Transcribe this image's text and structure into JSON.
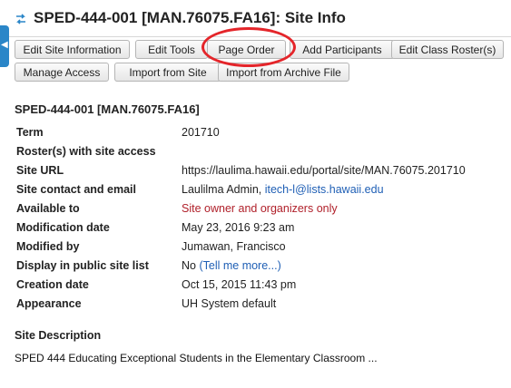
{
  "header": {
    "title": "SPED-444-001 [MAN.76075.FA16]: Site Info",
    "side_tab_icon": "chevron-left-icon",
    "title_icon": "swap-arrows-icon"
  },
  "toolbar": {
    "buttons": [
      {
        "label": "Edit Site Information"
      },
      {
        "label": "Edit Tools"
      },
      {
        "label": "Page Order"
      },
      {
        "label": "Add Participants"
      },
      {
        "label": "Edit Class Roster(s)"
      },
      {
        "label": "Manage Access"
      },
      {
        "label": "Import from Site"
      },
      {
        "label": "Import from Archive File"
      }
    ],
    "highlight_color": "#e4252a"
  },
  "site": {
    "section_title": "SPED-444-001 [MAN.76075.FA16]",
    "rows": [
      {
        "label": "Term",
        "value": "201710"
      },
      {
        "label": "Roster(s) with site access",
        "value": ""
      },
      {
        "label": "Site URL",
        "value": "https://laulima.hawaii.edu/portal/site/MAN.76075.201710"
      },
      {
        "label": "Site contact and email",
        "value": "Laulilma Admin,",
        "link": "itech-l@lists.hawaii.edu"
      },
      {
        "label": "Available to",
        "value": "Site owner and organizers only"
      },
      {
        "label": "Modification date",
        "value": "May 23, 2016 9:23 am"
      },
      {
        "label": "Modified by",
        "value": "Jumawan, Francisco"
      },
      {
        "label": "Display in public site list",
        "value": "No",
        "link": "(Tell me more...)"
      },
      {
        "label": "Creation date",
        "value": "Oct 15, 2015 11:43 pm"
      },
      {
        "label": "Appearance",
        "value": "UH System default"
      }
    ]
  },
  "description": {
    "title": "Site Description",
    "text": "SPED 444 Educating Exceptional Students in the Elementary Classroom ..."
  },
  "colors": {
    "link": "#1f5fb5",
    "restricted": "#b0202a",
    "side_tab": "#2a86c8"
  }
}
